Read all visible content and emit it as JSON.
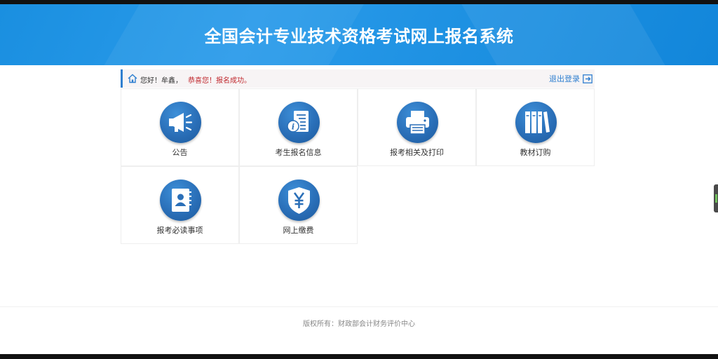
{
  "header": {
    "title": "全国会计专业技术资格考试网上报名系统"
  },
  "welcome": {
    "greeting": "您好！牟鑫，",
    "success_message": "恭喜您！报名成功。",
    "logout_label": "退出登录"
  },
  "menu": [
    {
      "label": "公告",
      "icon": "megaphone-icon"
    },
    {
      "label": "考生报名信息",
      "icon": "info-document-icon"
    },
    {
      "label": "报考相关及打印",
      "icon": "printer-icon"
    },
    {
      "label": "教材订购",
      "icon": "books-icon"
    },
    {
      "label": "报考必读事项",
      "icon": "contact-book-icon"
    },
    {
      "label": "网上缴费",
      "icon": "yen-shield-icon"
    }
  ],
  "footer": {
    "copyright": "版权所有：财政部会计财务评价中心"
  },
  "colors": {
    "header_blue": "#1a8fe0",
    "accent_blue": "#2f7fd0",
    "success_red": "#c0282d",
    "icon_circle": "#2a6fb8"
  }
}
